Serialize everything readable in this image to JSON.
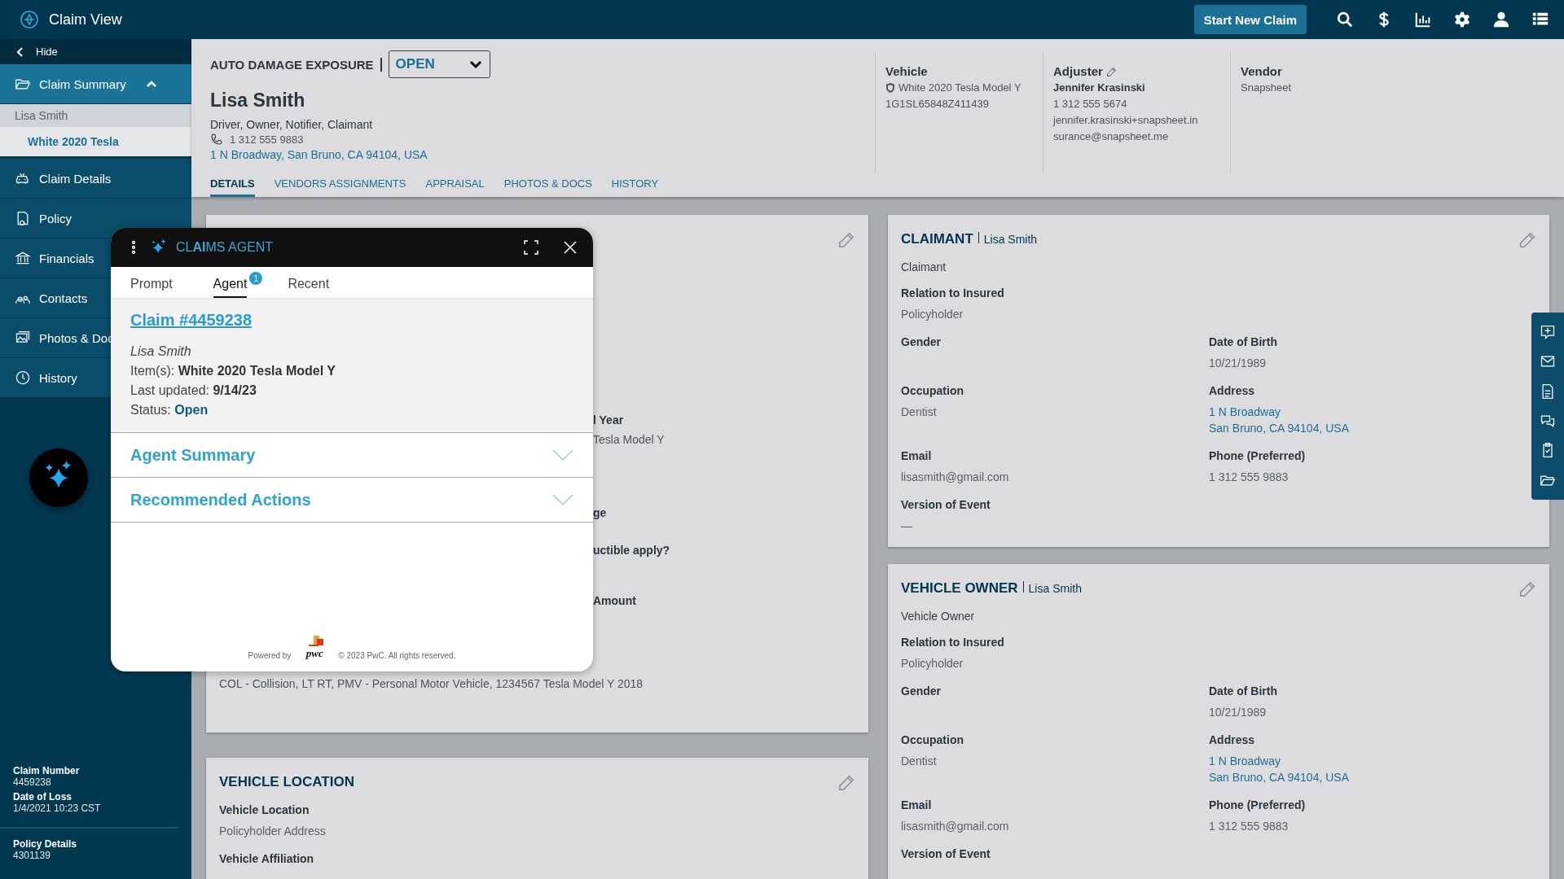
{
  "app": {
    "title": "Claim View",
    "new_claim_button": "Start New Claim"
  },
  "sidebar": {
    "hide": "Hide",
    "items": [
      {
        "label": "Claim Summary",
        "expanded": true,
        "children": [
          {
            "label": "Lisa Smith",
            "selected": false,
            "children": [
              {
                "label": "White 2020 Tesla",
                "selected": true
              }
            ]
          }
        ]
      },
      {
        "label": "Claim Details",
        "expanded": false
      },
      {
        "label": "Policy",
        "expanded": false
      },
      {
        "label": "Financials",
        "expanded": false
      },
      {
        "label": "Contacts",
        "expanded": false
      },
      {
        "label": "Photos & Doc",
        "expanded": false
      },
      {
        "label": "History",
        "expanded": false
      }
    ],
    "info_groups": [
      [
        {
          "label": "Claim Number",
          "value": "4459238"
        },
        {
          "label": "Date of Loss",
          "value": "1/4/2021 10:23 CST"
        }
      ],
      [
        {
          "label": "Policy Details",
          "value": "4301139"
        }
      ]
    ]
  },
  "header": {
    "exposure_label": "AUTO DAMAGE EXPOSURE",
    "status": "OPEN",
    "name": "Lisa Smith",
    "roles": "Driver, Owner, Notifier, Claimant",
    "phone": "1 312 555 9883",
    "address": "1 N Broadway, San Bruno, CA 94104, USA",
    "info_columns": [
      {
        "title": "Vehicle",
        "editable": false,
        "lines": [
          {
            "kind": "vehicle",
            "text": "White 2020 Tesla Model Y"
          },
          {
            "kind": "text",
            "text": "1G1SL65848Z411439"
          }
        ]
      },
      {
        "title": "Adjuster",
        "editable": true,
        "lines": [
          {
            "kind": "name",
            "text": "Jennifer Krasinski"
          },
          {
            "kind": "text",
            "text": "1 312 555 5674"
          },
          {
            "kind": "email",
            "text": "jennifer.krasinski+snapsheet.insurance@snapsheet.me"
          }
        ]
      },
      {
        "title": "Vendor",
        "editable": false,
        "lines": [
          {
            "kind": "text",
            "text": "Snapsheet"
          }
        ]
      }
    ],
    "tabs": [
      {
        "label": "DETAILS",
        "selected": true
      },
      {
        "label": "VENDORS ASSIGNMENTS",
        "selected": false
      },
      {
        "label": "APPRAISAL",
        "selected": false
      },
      {
        "label": "PHOTOS & DOCS",
        "selected": false
      },
      {
        "label": "HISTORY",
        "selected": false
      }
    ]
  },
  "details_card": {
    "visible_text": [
      {
        "kind": "label",
        "text": "l Year"
      },
      {
        "kind": "value",
        "text": "Tesla Model Y"
      },
      {
        "kind": "label",
        "text": "ge"
      },
      {
        "kind": "label",
        "text": "uctible apply?"
      },
      {
        "kind": "label",
        "text": "Amount"
      }
    ],
    "coverage": "COL - Collision, LT RT, PMV - Personal Motor Vehicle, 1234567 Tesla Model Y 2018"
  },
  "vehicle_location": {
    "title": "VEHICLE LOCATION",
    "fields": [
      {
        "kind": "wide",
        "label": "Vehicle Location",
        "lines": [
          "Policyholder Address"
        ]
      },
      {
        "kind": "wide",
        "label": "Vehicle Affiliation"
      }
    ]
  },
  "party_cards": [
    {
      "title": "CLAIMANT",
      "subtitle": "Lisa Smith",
      "role": "Claimant",
      "fields": [
        {
          "kind": "wide",
          "label": "Relation to Insured",
          "lines": [
            "Policyholder"
          ]
        },
        {
          "kind": "text",
          "label": "Gender"
        },
        {
          "kind": "text",
          "label": "Date of Birth",
          "lines": [
            "10/21/1989"
          ]
        },
        {
          "kind": "text",
          "label": "Occupation",
          "lines": [
            "Dentist"
          ]
        },
        {
          "kind": "link",
          "label": "Address",
          "lines": [
            "1 N Broadway",
            "San Bruno, CA 94104, USA"
          ]
        },
        {
          "kind": "text",
          "label": "Email",
          "lines": [
            "lisasmith@gmail.com"
          ]
        },
        {
          "kind": "text",
          "label": "Phone (Preferred)",
          "lines": [
            "1 312 555 9883"
          ]
        },
        {
          "kind": "wide",
          "label": "Version of Event",
          "lines": [
            "—"
          ]
        }
      ]
    },
    {
      "title": "VEHICLE OWNER",
      "subtitle": "Lisa Smith",
      "role": "Vehicle Owner",
      "fields": [
        {
          "kind": "wide",
          "label": "Relation to Insured",
          "lines": [
            "Policyholder"
          ]
        },
        {
          "kind": "text",
          "label": "Gender"
        },
        {
          "kind": "text",
          "label": "Date of Birth",
          "lines": [
            "10/21/1989"
          ]
        },
        {
          "kind": "text",
          "label": "Occupation",
          "lines": [
            "Dentist"
          ]
        },
        {
          "kind": "link",
          "label": "Address",
          "lines": [
            "1 N Broadway",
            "San Bruno, CA 94104, USA"
          ]
        },
        {
          "kind": "text",
          "label": "Email",
          "lines": [
            "lisasmith@gmail.com"
          ]
        },
        {
          "kind": "text",
          "label": "Phone (Preferred)",
          "lines": [
            "1 312 555 9883"
          ]
        },
        {
          "kind": "wide",
          "label": "Version of Event"
        }
      ]
    }
  ],
  "agent_panel": {
    "title": "CL**AI**MS AGENT",
    "tabs": [
      {
        "label": "Prompt",
        "selected": false
      },
      {
        "label": "Agent",
        "selected": true,
        "badge": "1"
      },
      {
        "label": "Recent",
        "selected": false
      }
    ],
    "claim": {
      "link": "Claim #4459238",
      "name": "Lisa Smith",
      "items": "Item(s): **White 2020 Tesla Model Y**",
      "updated": "Last updated: **9/14/23**",
      "status_label": "Status:",
      "status": "Open"
    },
    "sections": [
      {
        "title": "Agent Summary",
        "expanded": false
      },
      {
        "title": "Recommended Actions",
        "expanded": false
      }
    ],
    "footer": {
      "powered_by": "Powered by",
      "logo": "pwc",
      "copyright": "© 2023 PwC. All rights reserved."
    }
  }
}
